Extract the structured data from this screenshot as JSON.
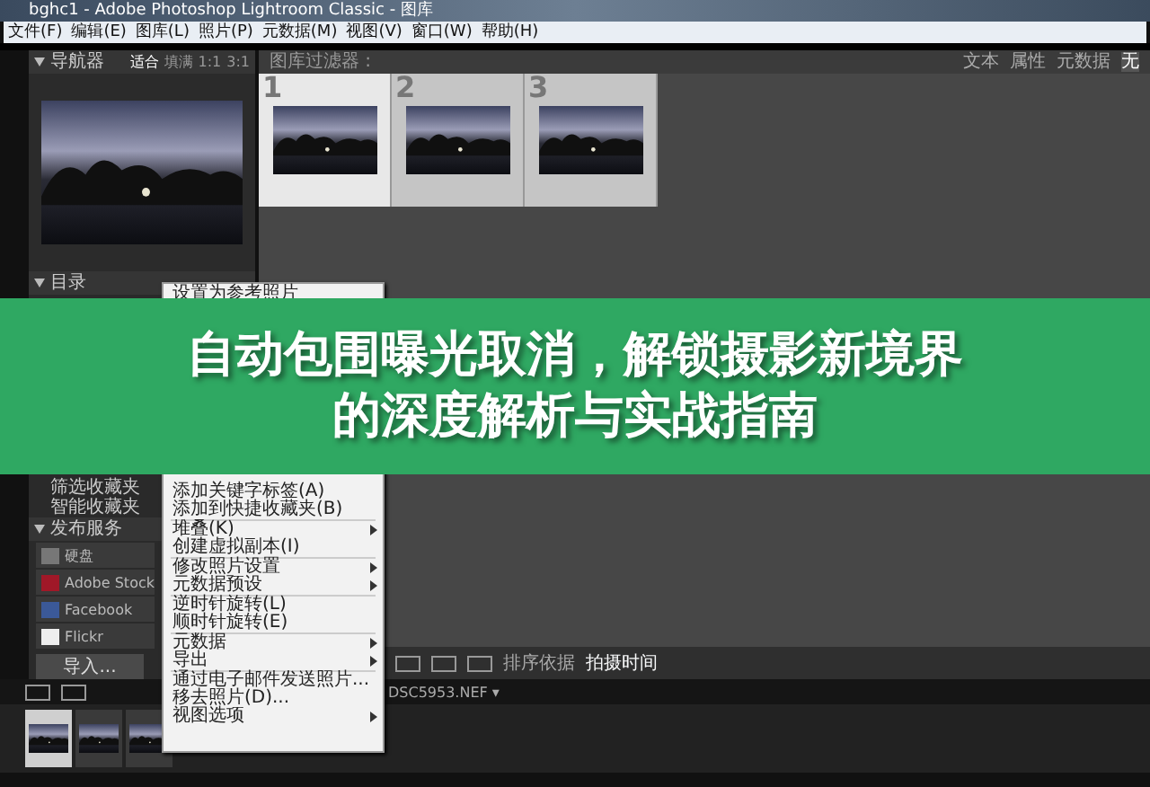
{
  "window": {
    "title": "bghc1 - Adobe Photoshop Lightroom Classic - 图库"
  },
  "menu_bar": [
    "文件(F)",
    "编辑(E)",
    "图库(L)",
    "照片(P)",
    "元数据(M)",
    "视图(V)",
    "窗口(W)",
    "帮助(H)"
  ],
  "navigator": {
    "title": "导航器",
    "zoom_options": [
      {
        "label": "适合",
        "selected": true
      },
      {
        "label": "填满",
        "selected": false
      },
      {
        "label": "1:1",
        "selected": false
      },
      {
        "label": "3:1",
        "selected": false
      }
    ]
  },
  "catalog": {
    "title": "目录"
  },
  "collections": {
    "items": [
      "筛选收藏夹",
      "智能收藏夹"
    ]
  },
  "publish_services": {
    "title": "发布服务",
    "items": [
      {
        "label": "硬盘",
        "kind": "disk"
      },
      {
        "label": "Adobe Stock",
        "kind": "stock"
      },
      {
        "label": "Facebook",
        "kind": "facebook"
      },
      {
        "label": "Flickr",
        "kind": "flickr"
      }
    ]
  },
  "panel_buttons": [
    "导入..."
  ],
  "library_filter": {
    "title": "图库过滤器 :",
    "options": [
      {
        "label": "文本",
        "selected": false
      },
      {
        "label": "属性",
        "selected": false
      },
      {
        "label": "元数据",
        "selected": false
      },
      {
        "label": "无",
        "selected": true
      }
    ]
  },
  "grid": [
    {
      "number": "1",
      "selected": true
    },
    {
      "number": "2",
      "selected": false
    },
    {
      "number": "3",
      "selected": false
    }
  ],
  "toolbar": {
    "sort_label": "排序依据",
    "sort_value": "拍摄时间"
  },
  "filmstrip": {
    "file": "DSC5953.NEF ▾",
    "thumbnails": [
      {
        "selected": true
      },
      {
        "selected": false
      },
      {
        "selected": false
      }
    ]
  },
  "context_menu_top": [
    {
      "kind": "item",
      "label": "设置为参考照片",
      "submenu": false
    }
  ],
  "context_menu": [
    {
      "kind": "item",
      "label": "添加关键字标签(A)",
      "submenu": false
    },
    {
      "kind": "item",
      "label": "添加到快捷收藏夹(B)",
      "submenu": false
    },
    {
      "kind": "separator"
    },
    {
      "kind": "item",
      "label": "堆叠(K)",
      "submenu": true
    },
    {
      "kind": "item",
      "label": "创建虚拟副本(I)",
      "submenu": false
    },
    {
      "kind": "separator"
    },
    {
      "kind": "item",
      "label": "修改照片设置",
      "submenu": true
    },
    {
      "kind": "item",
      "label": "元数据预设",
      "submenu": true
    },
    {
      "kind": "separator"
    },
    {
      "kind": "item",
      "label": "逆时针旋转(L)",
      "submenu": false
    },
    {
      "kind": "item",
      "label": "顺时针旋转(E)",
      "submenu": false
    },
    {
      "kind": "separator"
    },
    {
      "kind": "item",
      "label": "元数据",
      "submenu": true
    },
    {
      "kind": "item",
      "label": "导出",
      "submenu": true
    },
    {
      "kind": "separator"
    },
    {
      "kind": "item",
      "label": "通过电子邮件发送照片...",
      "submenu": false
    },
    {
      "kind": "item",
      "label": "移去照片(D)...",
      "submenu": false
    },
    {
      "kind": "item",
      "label": "视图选项",
      "submenu": true
    }
  ],
  "banner": {
    "lines": [
      "自动包围曝光取消，解锁摄影新境界",
      "的深度解析与实战指南"
    ]
  }
}
